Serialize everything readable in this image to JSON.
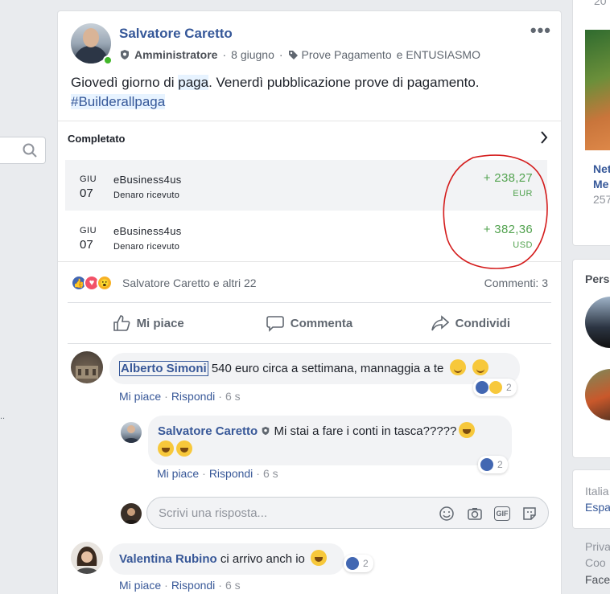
{
  "left": {
    "dots": ".."
  },
  "post": {
    "author": "Salvatore Caretto",
    "role": "Amministratore",
    "date": "8 giugno",
    "tag_a": "Prove Pagamento",
    "tag_join": "e",
    "tag_b": "ENTUSIASMO",
    "more": "•••",
    "text_1": "Giovedì giorno di ",
    "text_hl": "paga",
    "text_2": ". Venerdì pubblicazione prove di pagamento.",
    "hashtag": "#Builderallpaga"
  },
  "embed": {
    "title": "Completato",
    "rows": [
      {
        "month": "GIU",
        "day": "07",
        "name": "eBusiness4us",
        "desc": "Denaro ricevuto",
        "amount": "+ 238,27",
        "currency": "EUR"
      },
      {
        "month": "GIU",
        "day": "07",
        "name": "eBusiness4us",
        "desc": "Denaro ricevuto",
        "amount": "+ 382,36",
        "currency": "USD"
      }
    ]
  },
  "reactions": {
    "who": "Salvatore Caretto e altri 22",
    "comments": "Commenti: 3"
  },
  "actions": {
    "like": "Mi piace",
    "comment": "Commenta",
    "share": "Condividi"
  },
  "comments": [
    {
      "name": "Alberto Simoni",
      "text": " 540 euro circa a settimana, mannaggia a te",
      "like": "Mi piace",
      "reply": "Rispondi",
      "time": "6 s",
      "count": "2"
    },
    {
      "name": "Salvatore Caretto",
      "text": " Mi stai a fare i conti in tasca?????",
      "like": "Mi piace",
      "reply": "Rispondi",
      "time": "6 s",
      "count": "2"
    },
    {
      "name": "Valentina Rubino",
      "text": " ci arrivo anch io",
      "like": "Mi piace",
      "reply": "Rispondi",
      "time": "6 s",
      "count": "2"
    }
  ],
  "reply_box": {
    "placeholder": "Scrivi una risposta...",
    "gif": "GIF"
  },
  "right": {
    "top": "20",
    "card_title_1": "Net",
    "card_title_2": "Me",
    "card_sub": "257",
    "section": "Pers",
    "lang_1": "Italia",
    "lang_2": "Espa",
    "foot_1": "Priva",
    "foot_2": "Coo",
    "foot_3": "Face"
  },
  "colors": {
    "link": "#365899",
    "green": "#53a350",
    "annotation": "#d41b1b",
    "online": "#42b72a"
  }
}
